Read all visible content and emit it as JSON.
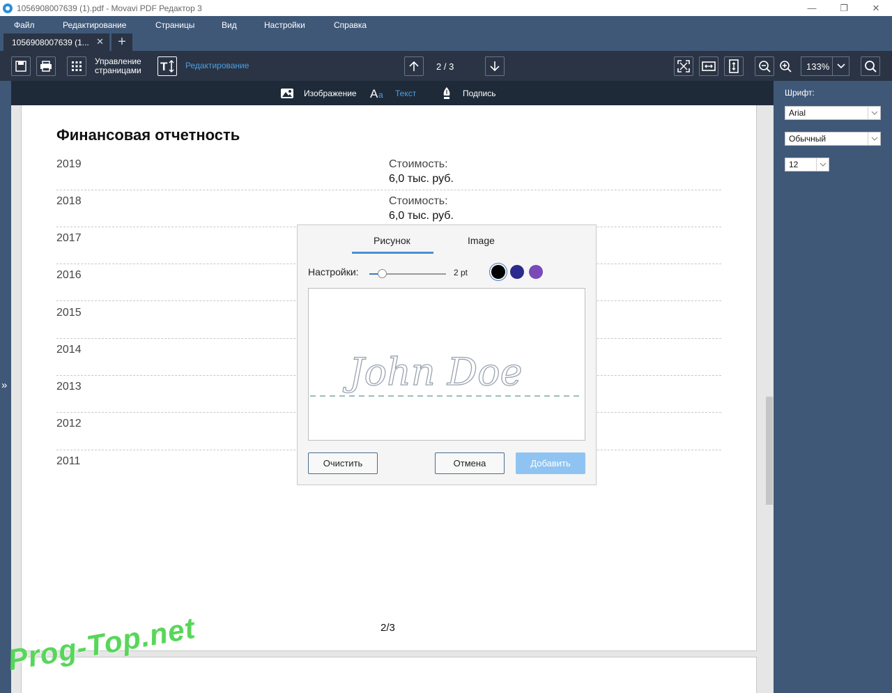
{
  "window": {
    "title": "1056908007639 (1).pdf - Movavi PDF Редактор 3",
    "controls": {
      "minimize": "—",
      "restore": "❐",
      "close": "✕"
    }
  },
  "menu": {
    "items": [
      "Файл",
      "Редактирование",
      "Страницы",
      "Вид",
      "Настройки",
      "Справка"
    ]
  },
  "tabs": {
    "current": "1056908007639 (1...",
    "close_glyph": "✕",
    "add_glyph": "+"
  },
  "toolbar": {
    "page_manage_line1": "Управление",
    "page_manage_line2": "страницами",
    "edit_label": "Редактирование",
    "page_indicator": "2 / 3",
    "zoom": "133%"
  },
  "subtoolbar": {
    "image": "Изображение",
    "text": "Текст",
    "signature": "Подпись"
  },
  "document": {
    "title": "Финансовая отчетность",
    "rows": [
      {
        "year": "2019",
        "cost_label": "Стоимость:",
        "cost_value": "6,0 тыс. руб."
      },
      {
        "year": "2018",
        "cost_label": "Стоимость:",
        "cost_value": "6,0 тыс. руб."
      },
      {
        "year": "2017"
      },
      {
        "year": "2016"
      },
      {
        "year": "2015"
      },
      {
        "year": "2014"
      },
      {
        "year": "2013"
      },
      {
        "year": "2012"
      },
      {
        "year": "2011"
      }
    ],
    "page_number": "2/3"
  },
  "right_panel": {
    "font_label": "Шрифт:",
    "font_family": "Arial",
    "font_style": "Обычный",
    "font_size": "12"
  },
  "signature_dialog": {
    "tab_draw": "Рисунок",
    "tab_image": "Image",
    "settings_label": "Настройки:",
    "thickness": "2 pt",
    "thickness_fraction": 0.15,
    "colors": [
      "#000000",
      "#2c2a8c",
      "#7a4ab8"
    ],
    "selected_color": "#000000",
    "signature_text": "John Doe",
    "clear_button": "Очистить",
    "cancel_button": "Отмена",
    "add_button": "Добавить"
  },
  "watermark": "Prog-Top.net",
  "left_rail": {
    "expand_glyph": "»"
  },
  "colors": {
    "accent": "#4aa0e6",
    "toolbar_bg": "#2a3444",
    "frame_bg": "#3f5878"
  }
}
